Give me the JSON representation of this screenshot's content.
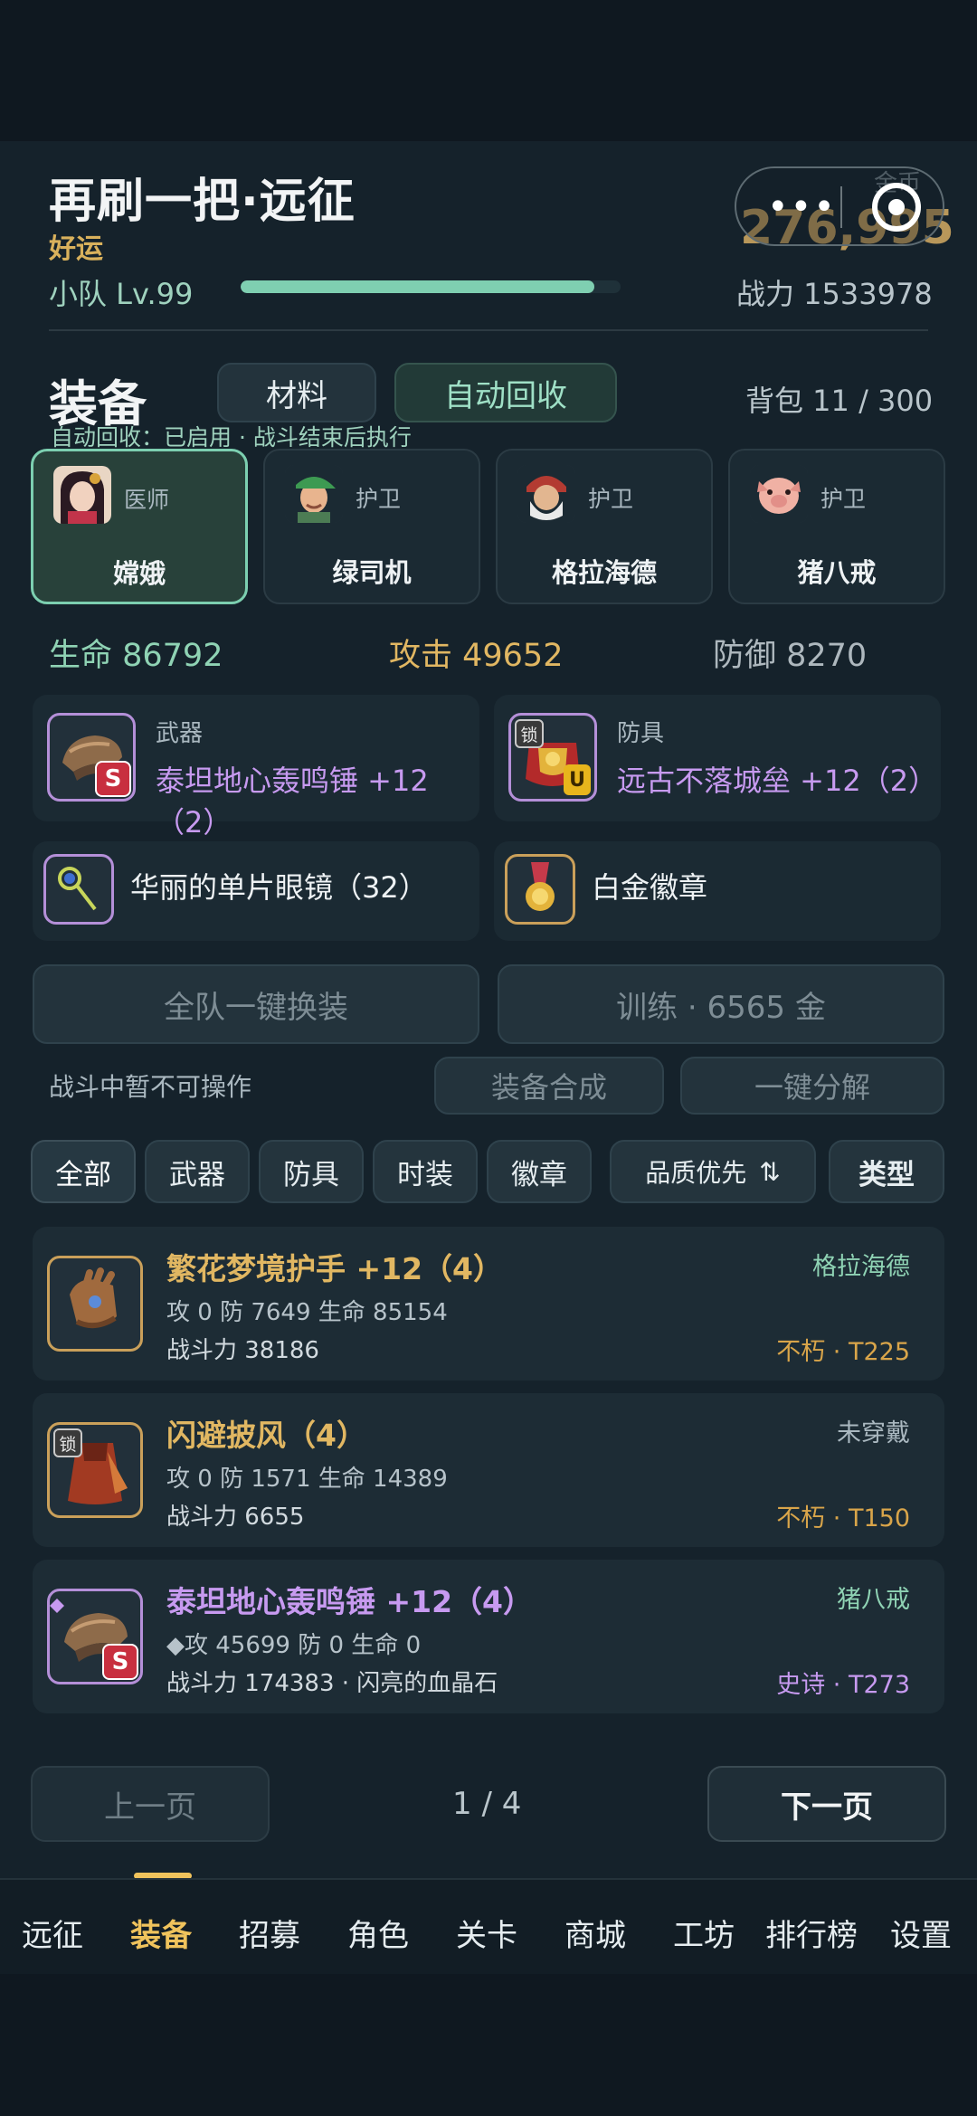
{
  "header": {
    "title": "再刷一把·远征",
    "subtitle": "好运",
    "team_level": "小队 Lv.99",
    "level_progress": 0.93,
    "coin_label": "金币",
    "coins": "276,995",
    "power": "战力 1533978"
  },
  "capsule": {
    "more_icon": "more-dots-icon",
    "close_icon": "target-close-icon"
  },
  "equip_section": {
    "title": "装备",
    "tabs": [
      "材料",
      "自动回收"
    ],
    "bag": "背包 11 / 300",
    "auto_note": "自动回收：已启用 · 战斗结束后执行"
  },
  "heroes": [
    {
      "role": "医师",
      "name": "嫦娥",
      "selected": true
    },
    {
      "role": "护卫",
      "name": "绿司机",
      "selected": false
    },
    {
      "role": "护卫",
      "name": "格拉海德",
      "selected": false
    },
    {
      "role": "护卫",
      "name": "猪八戒",
      "selected": false
    }
  ],
  "stats": {
    "hp": "生命 86792",
    "atk": "攻击 49652",
    "def": "防御 8270"
  },
  "slots": {
    "weapon": {
      "label": "武器",
      "name": "泰坦地心轰鸣锤 +12（2）",
      "badge": "S"
    },
    "armor": {
      "label": "防具",
      "name": "远古不落城垒 +12（2）",
      "lock": "锁",
      "badge": "U"
    },
    "accessory": {
      "name": "华丽的单片眼镜（32）"
    },
    "medal": {
      "name": "白金徽章"
    }
  },
  "actions": {
    "equip_all": "全队一键换装",
    "train": "训练 · 6565 金",
    "disabled_note": "战斗中暂不可操作",
    "craft": "装备合成",
    "dismantle": "一键分解"
  },
  "filters": {
    "all": "全部",
    "weapon": "武器",
    "armor": "防具",
    "fashion": "时装",
    "medal": "徽章",
    "sort": "品质优先",
    "sort_icon": "⇅",
    "type": "类型"
  },
  "items": [
    {
      "name": "繁花梦境护手 +12（4）",
      "stats": "攻 0  防 7649  生命 85154",
      "power": "战斗力 38186",
      "owner": "格拉海德",
      "rarity": "不朽 · T225"
    },
    {
      "name": "闪避披风（4）",
      "stats": "攻 0  防 1571  生命 14389",
      "power": "战斗力 6655",
      "owner": "未穿戴",
      "rarity": "不朽 · T150",
      "lock": "锁"
    },
    {
      "name": "泰坦地心轰鸣锤 +12（4）",
      "stats": "◆攻 45699  防 0  生命 0",
      "power": "战斗力 174383 · 闪亮的血晶石",
      "owner": "猪八戒",
      "rarity": "史诗 · T273",
      "badge": "S"
    }
  ],
  "pagination": {
    "prev": "上一页",
    "page": "1 / 4",
    "next": "下一页"
  },
  "nav": [
    "远征",
    "装备",
    "招募",
    "角色",
    "关卡",
    "商城",
    "工坊",
    "排行榜",
    "设置"
  ],
  "nav_active": "装备",
  "colors": {
    "accent_green": "#7fcfb1",
    "gold": "#d9b15c",
    "purple": "#c79af0",
    "rarity_gold": "#d9a54a"
  }
}
